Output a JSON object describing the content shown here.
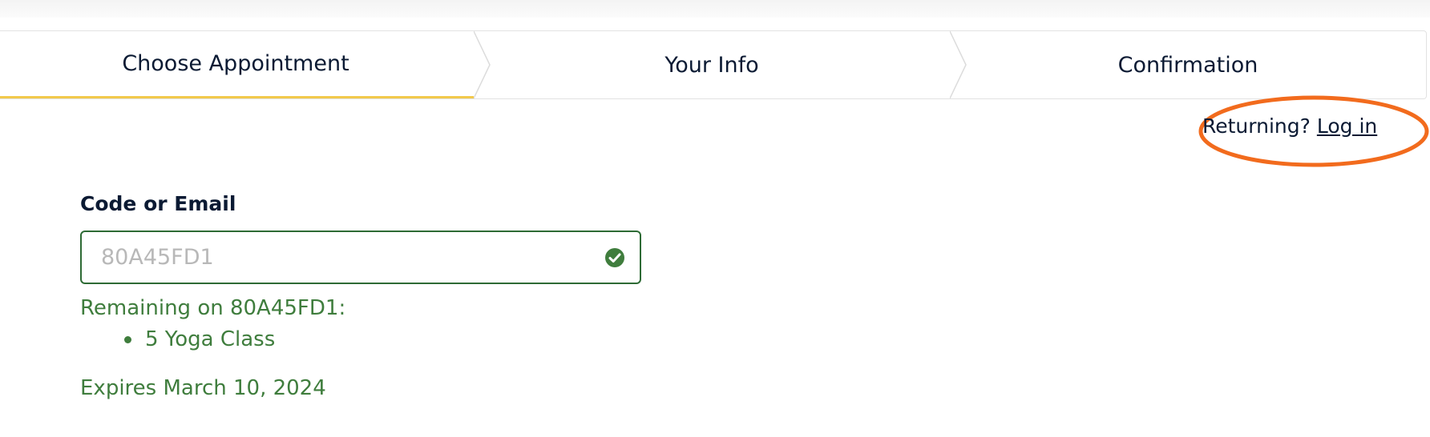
{
  "steps": [
    {
      "label": "Choose Appointment",
      "active": true
    },
    {
      "label": "Your Info",
      "active": false
    },
    {
      "label": "Confirmation",
      "active": false
    }
  ],
  "login": {
    "prompt": "Returning?",
    "link": "Log in"
  },
  "form": {
    "label": "Code or Email",
    "value": "80A45FD1",
    "status_icon": "check-circle-icon"
  },
  "remaining": {
    "heading": "Remaining on 80A45FD1:",
    "items": [
      "5 Yoga Class"
    ],
    "expires": "Expires March 10, 2024"
  },
  "colors": {
    "active_step_underline": "#f2c94c",
    "success_green": "#3f7d3d",
    "input_border": "#2e6b35",
    "highlight": "#f26b1d",
    "text": "#0b1a33"
  }
}
